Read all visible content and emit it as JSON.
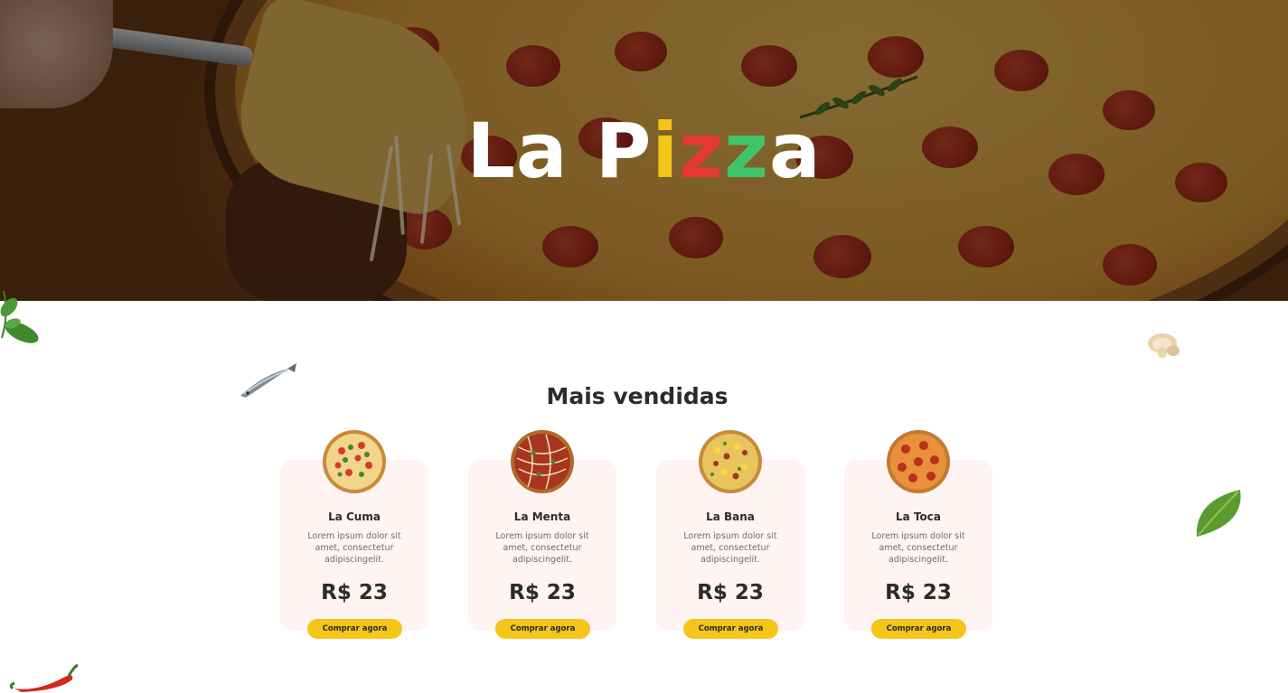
{
  "hero": {
    "title_letters": [
      "La P",
      "i",
      "z",
      "z",
      "a"
    ],
    "title_colors": [
      "#ffffff",
      "#f5c518",
      "#e53935",
      "#3fc46a",
      "#ffffff"
    ]
  },
  "section": {
    "title": "Mais vendidas"
  },
  "cards": [
    {
      "name": "La Cuma",
      "description": "Lorem ipsum dolor sit amet, consectetur adipiscingelit.",
      "price": "R$ 23",
      "button": "Comprar agora",
      "image": "pizza-vegetable-icon"
    },
    {
      "name": "La Menta",
      "description": "Lorem ipsum dolor sit amet, consectetur adipiscingelit.",
      "price": "R$ 23",
      "button": "Comprar agora",
      "image": "pizza-drizzle-icon"
    },
    {
      "name": "La Bana",
      "description": "Lorem ipsum dolor sit amet, consectetur adipiscingelit.",
      "price": "R$ 23",
      "button": "Comprar agora",
      "image": "pizza-pineapple-icon"
    },
    {
      "name": "La Toca",
      "description": "Lorem ipsum dolor sit amet, consectetur adipiscingelit.",
      "price": "R$ 23",
      "button": "Comprar agora",
      "image": "pizza-pepperoni-icon"
    }
  ],
  "colors": {
    "accent": "#f5c518",
    "card_bg": "#fff4f1"
  }
}
